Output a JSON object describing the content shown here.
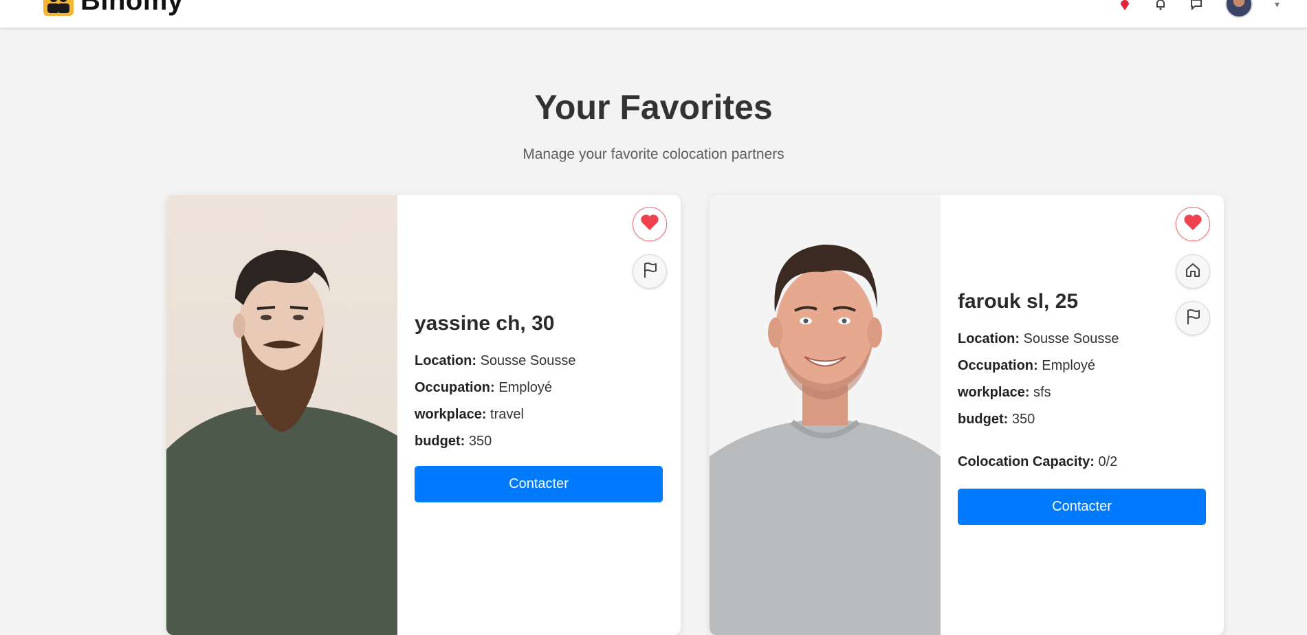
{
  "app": {
    "brand_name": "Binomy"
  },
  "header": {
    "title": "Your Favorites",
    "subtitle": "Manage your favorite colocation partners"
  },
  "colors": {
    "accent": "#007bff",
    "favorite": "#f0414f",
    "background": "#f3f3f3"
  },
  "cards": [
    {
      "name_age": "yassine ch, 30",
      "photo_icon": "person-photo-bearded-man",
      "fields": [
        {
          "label": "Location:",
          "value": "Sousse Sousse"
        },
        {
          "label": "Occupation:",
          "value": "Employé"
        },
        {
          "label": "workplace:",
          "value": "travel"
        },
        {
          "label": "budget:",
          "value": "350"
        }
      ],
      "actions": [
        "heart-icon",
        "flag-icon"
      ],
      "contact_label": "Contacter"
    },
    {
      "name_age": "farouk sl, 25",
      "photo_icon": "person-photo-smiling-man",
      "fields": [
        {
          "label": "Location:",
          "value": "Sousse Sousse"
        },
        {
          "label": "Occupation:",
          "value": "Employé"
        },
        {
          "label": "workplace:",
          "value": "sfs"
        },
        {
          "label": "budget:",
          "value": "350"
        }
      ],
      "capacity": {
        "label": "Colocation Capacity:",
        "value": "0/2"
      },
      "actions": [
        "heart-icon",
        "home-icon",
        "flag-icon"
      ],
      "contact_label": "Contacter"
    }
  ]
}
